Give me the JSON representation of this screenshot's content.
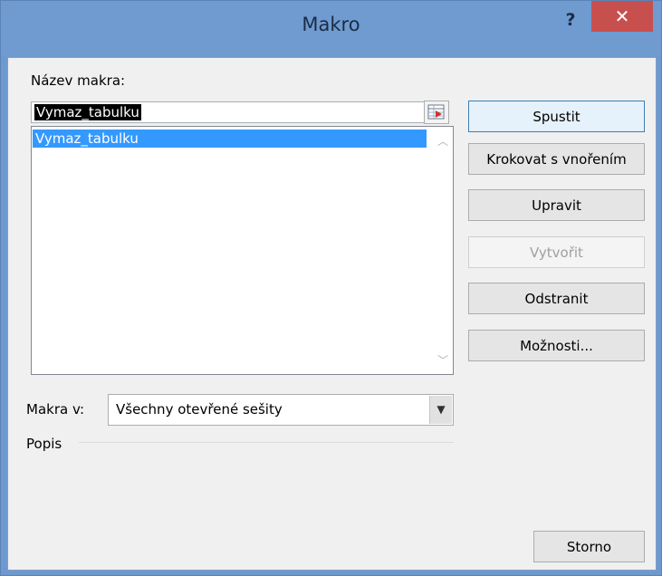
{
  "window": {
    "title": "Makro",
    "help_label": "?",
    "close_label": "✕"
  },
  "labels": {
    "macro_name": "Název makra:",
    "macros_in": "Makra v:",
    "description": "Popis"
  },
  "name_input": {
    "value": "Vymaz_tabulku"
  },
  "macro_list": {
    "items": [
      "Vymaz_tabulku"
    ],
    "selected_index": 0
  },
  "macros_in_select": {
    "value": "Všechny otevřené sešity"
  },
  "buttons": {
    "run": "Spustit",
    "step_into": "Krokovat s vnořením",
    "edit": "Upravit",
    "create": "Vytvořit",
    "delete": "Odstranit",
    "options": "Možnosti...",
    "cancel": "Storno"
  },
  "colors": {
    "titlebar": "#6f9bd1",
    "close": "#c7504f",
    "selection": "#3399ff"
  },
  "icons": {
    "ref_button": "collapse-dialog-icon",
    "scroll_up": "chevron-up-icon",
    "scroll_down": "chevron-down-icon",
    "dropdown": "chevron-down-icon"
  }
}
